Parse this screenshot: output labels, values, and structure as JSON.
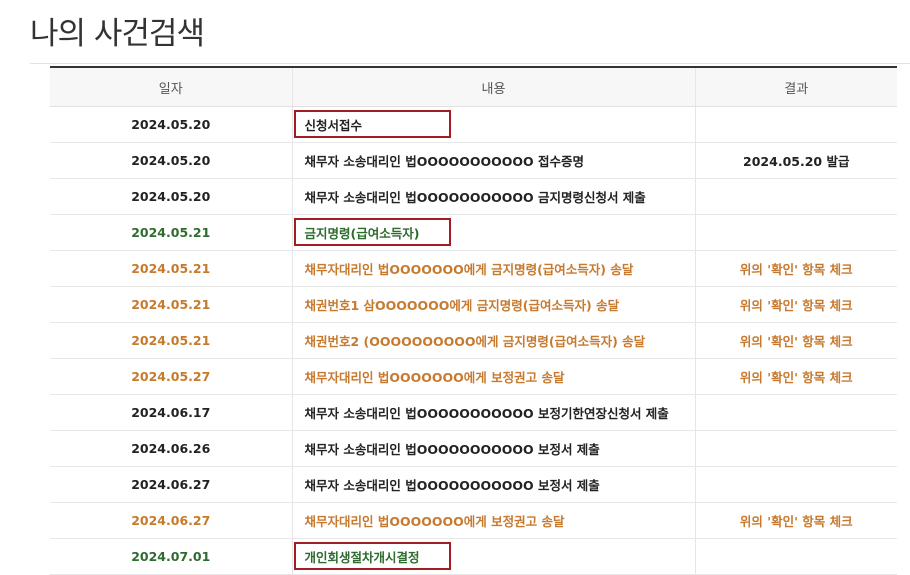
{
  "page": {
    "title": "나의 사건검색"
  },
  "table": {
    "headers": {
      "date": "일자",
      "content": "내용",
      "result": "결과"
    },
    "rows": [
      {
        "date": "2024.05.20",
        "content": "신청서접수",
        "result": "",
        "tone": "dark",
        "highlighted": true
      },
      {
        "date": "2024.05.20",
        "content": "채무자 소송대리인 법OOOOOOOOOOO 접수증명",
        "result": "2024.05.20 발급",
        "tone": "dark",
        "highlighted": false
      },
      {
        "date": "2024.05.20",
        "content": "채무자 소송대리인 법OOOOOOOOOOO 금지명령신청서 제출",
        "result": "",
        "tone": "dark",
        "highlighted": false
      },
      {
        "date": "2024.05.21",
        "content": "금지명령(급여소득자)",
        "result": "",
        "tone": "green",
        "highlighted": true
      },
      {
        "date": "2024.05.21",
        "content": "채무자대리인 법OOOOOOO에게 금지명령(급여소득자) 송달",
        "result": "위의 '확인' 항목 체크",
        "tone": "orange",
        "highlighted": false
      },
      {
        "date": "2024.05.21",
        "content": "채권번호1 삼OOOOOOO에게 금지명령(급여소득자) 송달",
        "result": "위의 '확인' 항목 체크",
        "tone": "orange",
        "highlighted": false
      },
      {
        "date": "2024.05.21",
        "content": "채권번호2 (OOOOOOOOOO에게 금지명령(급여소득자) 송달",
        "result": "위의 '확인' 항목 체크",
        "tone": "orange",
        "highlighted": false
      },
      {
        "date": "2024.05.27",
        "content": "채무자대리인 법OOOOOOO에게 보정권고 송달",
        "result": "위의 '확인' 항목 체크",
        "tone": "orange",
        "highlighted": false
      },
      {
        "date": "2024.06.17",
        "content": "채무자 소송대리인 법OOOOOOOOOOO 보정기한연장신청서 제출",
        "result": "",
        "tone": "dark",
        "highlighted": false
      },
      {
        "date": "2024.06.26",
        "content": "채무자 소송대리인 법OOOOOOOOOOO 보정서 제출",
        "result": "",
        "tone": "dark",
        "highlighted": false
      },
      {
        "date": "2024.06.27",
        "content": "채무자 소송대리인 법OOOOOOOOOOO 보정서 제출",
        "result": "",
        "tone": "dark",
        "highlighted": false
      },
      {
        "date": "2024.06.27",
        "content": "채무자대리인 법OOOOOOO에게 보정권고 송달",
        "result": "위의 '확인' 항목 체크",
        "tone": "orange",
        "highlighted": false
      },
      {
        "date": "2024.07.01",
        "content": "개인회생절차개시결정",
        "result": "",
        "tone": "green",
        "highlighted": true
      }
    ]
  },
  "colors": {
    "dark_text": "#222222",
    "green_text": "#2e6b2e",
    "orange_text": "#c7792d",
    "highlight_border": "#a01d24"
  }
}
